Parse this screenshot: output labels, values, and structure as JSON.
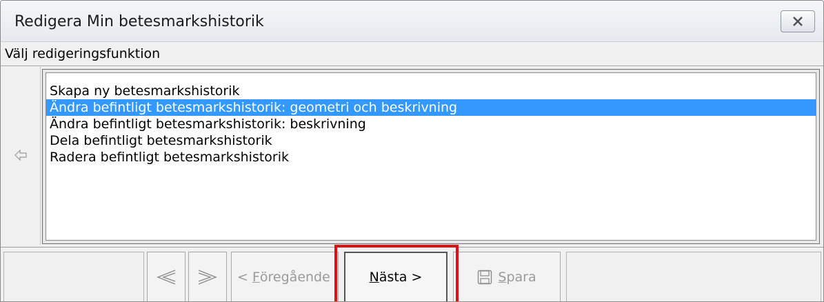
{
  "window": {
    "title": "Redigera Min betesmarkshistorik"
  },
  "section": {
    "label": "Välj redigeringsfunktion"
  },
  "list": {
    "items": [
      {
        "label": "Skapa ny betesmarkshistorik",
        "selected": false
      },
      {
        "label": "Ändra befintligt betesmarkshistorik: geometri och beskrivning",
        "selected": true
      },
      {
        "label": "Ändra befintligt betesmarkshistorik: beskrivning",
        "selected": false
      },
      {
        "label": "Dela befintligt betesmarkshistorik",
        "selected": false
      },
      {
        "label": "Radera befintligt betesmarkshistorik",
        "selected": false
      }
    ]
  },
  "toolbar": {
    "prev_mnemonic": "F",
    "prev_rest": "öregående",
    "prev_prefix": "< ",
    "next_mnemonic": "N",
    "next_rest": "ästa >",
    "save_mnemonic": "S",
    "save_rest": "para"
  },
  "colors": {
    "selection": "#3399ff",
    "highlight": "#e01010"
  },
  "icons": {
    "close": "close-icon",
    "back": "arrow-left-icon",
    "prev_arrow": "triangle-left-icon",
    "next_arrow": "triangle-right-icon",
    "save": "floppy-disk-icon"
  }
}
